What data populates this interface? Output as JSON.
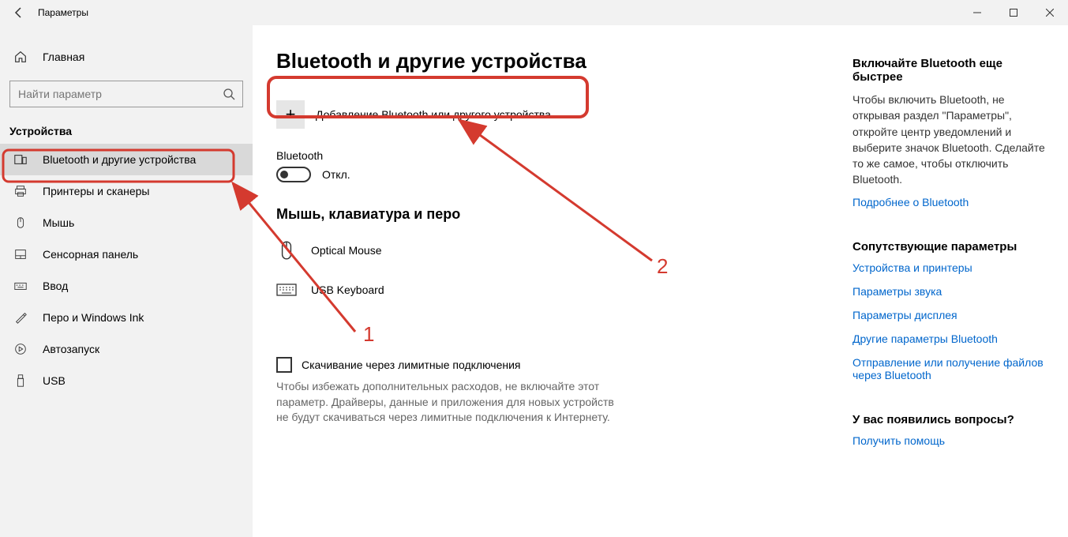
{
  "titlebar": {
    "title": "Параметры"
  },
  "sidebar": {
    "home": "Главная",
    "search_placeholder": "Найти параметр",
    "section": "Устройства",
    "items": [
      {
        "label": "Bluetooth и другие устройства",
        "active": true
      },
      {
        "label": "Принтеры и сканеры"
      },
      {
        "label": "Мышь"
      },
      {
        "label": "Сенсорная панель"
      },
      {
        "label": "Ввод"
      },
      {
        "label": "Перо и Windows Ink"
      },
      {
        "label": "Автозапуск"
      },
      {
        "label": "USB"
      }
    ]
  },
  "center": {
    "page_title": "Bluetooth и другие устройства",
    "add_device": "Добавление Bluetooth или другого устройства",
    "bt_label": "Bluetooth",
    "bt_state": "Откл.",
    "subhead": "Мышь, клавиатура и перо",
    "devices": [
      {
        "name": "Optical Mouse"
      },
      {
        "name": "USB Keyboard"
      }
    ],
    "checkbox_label": "Скачивание через лимитные подключения",
    "checkbox_desc": "Чтобы избежать дополнительных расходов, не включайте этот параметр. Драйверы, данные и приложения для новых устройств не будут скачиваться через лимитные подключения к Интернету."
  },
  "right": {
    "t1": "Включайте Bluetooth еще быстрее",
    "p1": "Чтобы включить Bluetooth, не открывая раздел \"Параметры\", откройте центр уведомлений и выберите значок Bluetooth. Сделайте то же самое, чтобы отключить Bluetooth.",
    "link1": "Подробнее о Bluetooth",
    "t2": "Сопутствующие параметры",
    "links2": [
      "Устройства и принтеры",
      "Параметры звука",
      "Параметры дисплея",
      "Другие параметры Bluetooth",
      "Отправление или получение файлов через Bluetooth"
    ],
    "t3": "У вас появились вопросы?",
    "link3": "Получить помощь"
  },
  "annotations": {
    "n1": "1",
    "n2": "2"
  }
}
